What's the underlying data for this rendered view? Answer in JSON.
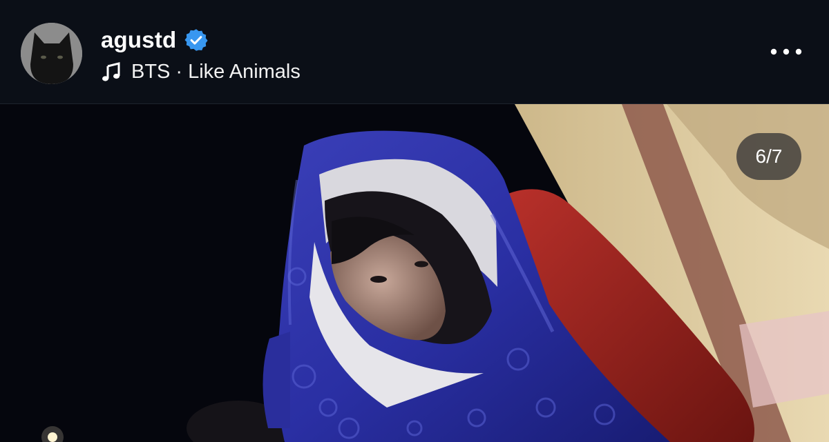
{
  "post": {
    "username": "agustd",
    "verified": true,
    "music": {
      "artist": "BTS",
      "separator": "·",
      "title": "Like Animals",
      "icon": "music-note-icon"
    },
    "more_icon": "more-horizontal-icon",
    "media": {
      "counter": "6/7"
    }
  },
  "colors": {
    "background": "#0b0f17",
    "verified_badge": "#3897f0",
    "text": "#ffffff"
  }
}
